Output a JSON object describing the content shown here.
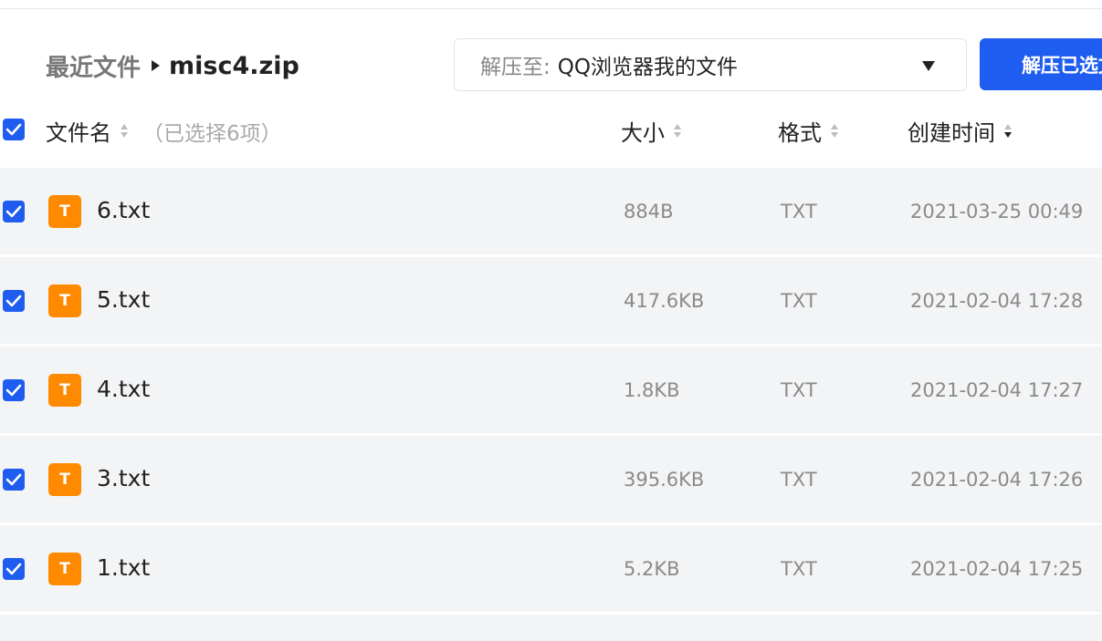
{
  "breadcrumb": {
    "root": "最近文件",
    "current": "misc4.zip"
  },
  "destination": {
    "label": "解压至:",
    "value": "QQ浏览器我的文件"
  },
  "extract_button": "解压已选文件",
  "table": {
    "columns": {
      "name": "文件名",
      "selection": "（已选择6项）",
      "size": "大小",
      "format": "格式",
      "created": "创建时间"
    },
    "rows": [
      {
        "name": "6.txt",
        "size": "884B",
        "format": "TXT",
        "created": "2021-03-25 00:49",
        "icon_letter": "T"
      },
      {
        "name": "5.txt",
        "size": "417.6KB",
        "format": "TXT",
        "created": "2021-02-04 17:28",
        "icon_letter": "T"
      },
      {
        "name": "4.txt",
        "size": "1.8KB",
        "format": "TXT",
        "created": "2021-02-04 17:27",
        "icon_letter": "T"
      },
      {
        "name": "3.txt",
        "size": "395.6KB",
        "format": "TXT",
        "created": "2021-02-04 17:26",
        "icon_letter": "T"
      },
      {
        "name": "1.txt",
        "size": "5.2KB",
        "format": "TXT",
        "created": "2021-02-04 17:25",
        "icon_letter": "T"
      }
    ]
  },
  "colors": {
    "accent": "#1f5cf0",
    "file_icon": "#ff8a00",
    "row_background": "#f3f4f6"
  }
}
